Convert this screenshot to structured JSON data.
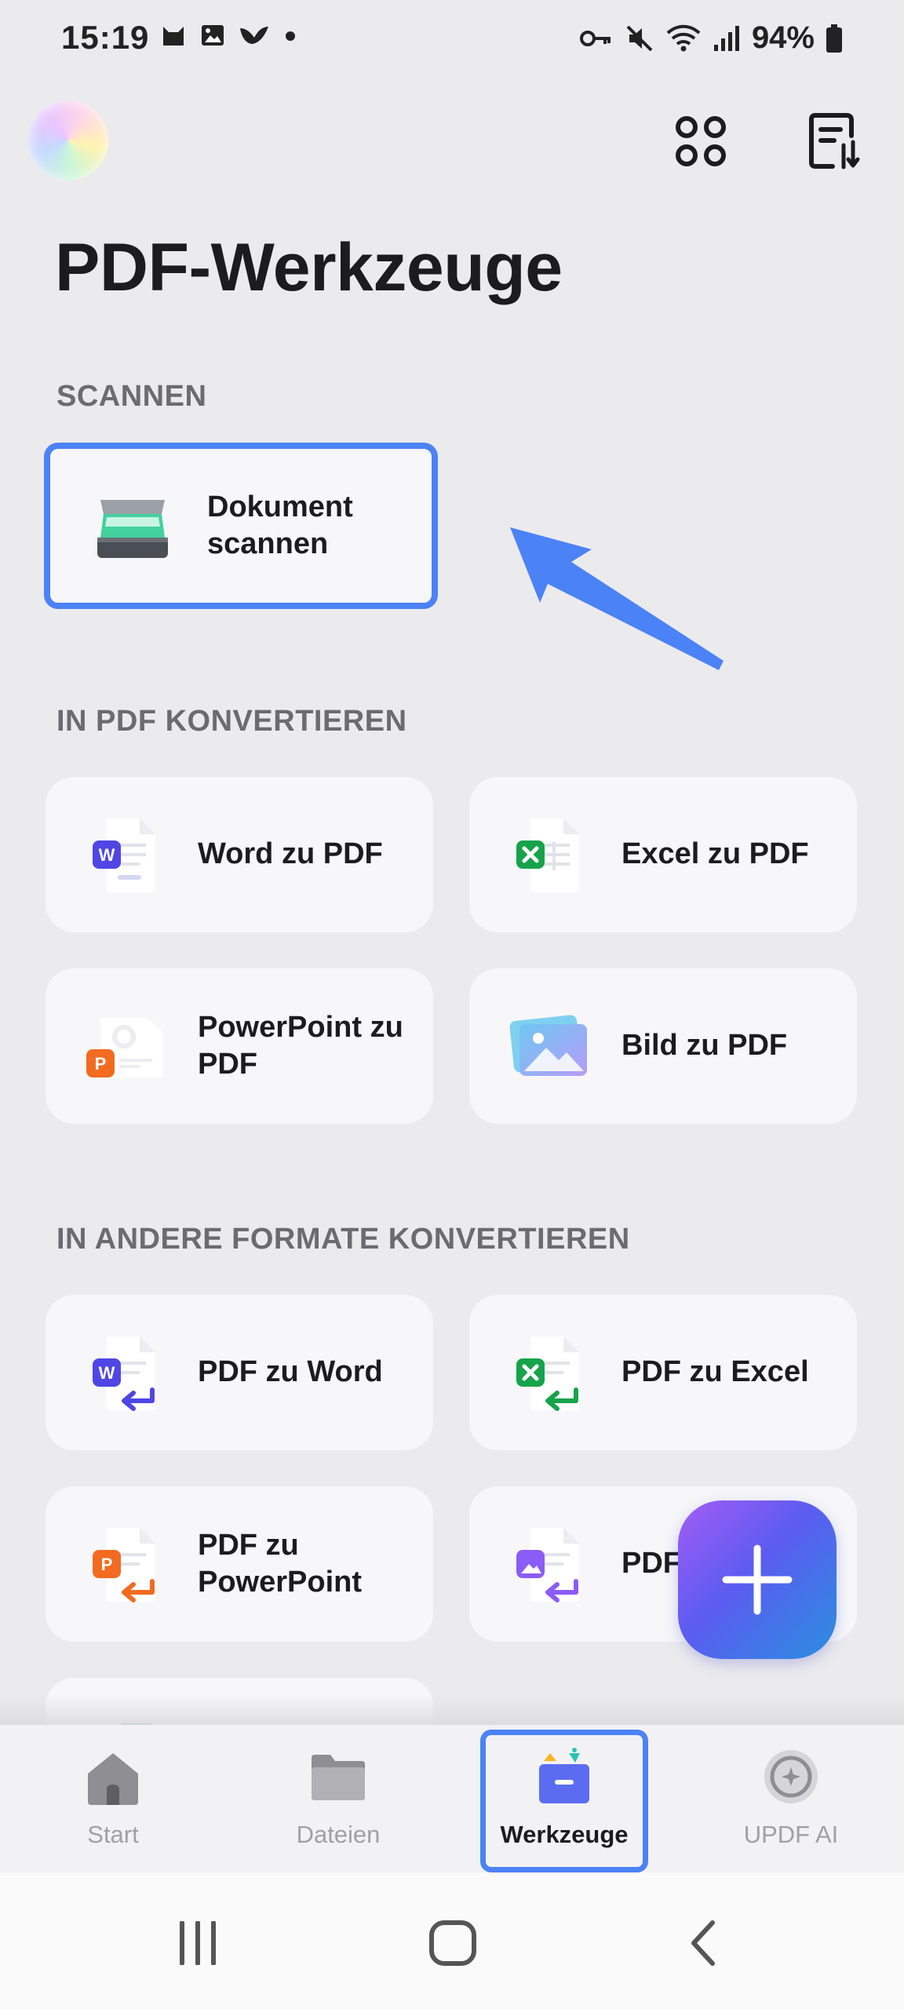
{
  "status_bar": {
    "time": "15:19",
    "battery": "94%"
  },
  "header": {
    "title": "PDF-Werkzeuge"
  },
  "sections": {
    "scan": {
      "label": "SCANNEN",
      "scan_document": "Dokument\nscannen"
    },
    "to_pdf": {
      "label": "IN PDF KONVERTIEREN",
      "word": "Word zu PDF",
      "excel": "Excel zu PDF",
      "powerpoint": "PowerPoint zu PDF",
      "image": "Bild zu PDF"
    },
    "from_pdf": {
      "label": "IN ANDERE FORMATE KONVERTIEREN",
      "word": "PDF zu Word",
      "excel": "PDF zu Excel",
      "powerpoint": "PDF zu\nPowerPoint",
      "image_partial": "PDF"
    }
  },
  "bottom_nav": {
    "start": "Start",
    "files": "Dateien",
    "tools": "Werkzeuge",
    "ai": "UPDF AI"
  },
  "colors": {
    "accent": "#4b82f5",
    "word": "#4f46e5",
    "excel": "#16a34a",
    "powerpoint": "#f26b21",
    "image": "#8b5cf6"
  }
}
